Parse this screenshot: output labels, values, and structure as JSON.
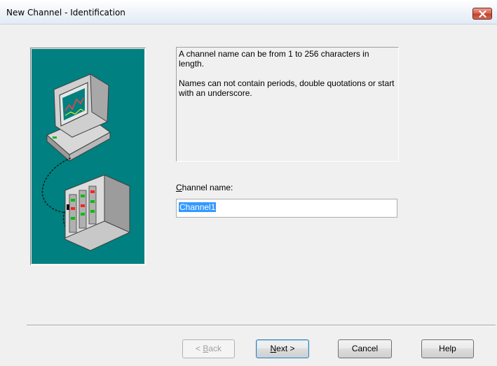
{
  "window": {
    "title": "New Channel - Identification"
  },
  "info": {
    "line1": "A channel name can be from 1 to 256 characters in length.",
    "line2": "Names can not contain periods, double quotations or start with an underscore."
  },
  "channel_name": {
    "label_mnemonic": "C",
    "label_rest": "hannel name:",
    "value": "Channel1"
  },
  "buttons": {
    "back_prefix": "< ",
    "back_mnemonic": "B",
    "back_rest": "ack",
    "next_mnemonic": "N",
    "next_rest": "ext >",
    "cancel": "Cancel",
    "help": "Help"
  },
  "colors": {
    "art_background": "#008080",
    "selection": "#3399ff"
  }
}
